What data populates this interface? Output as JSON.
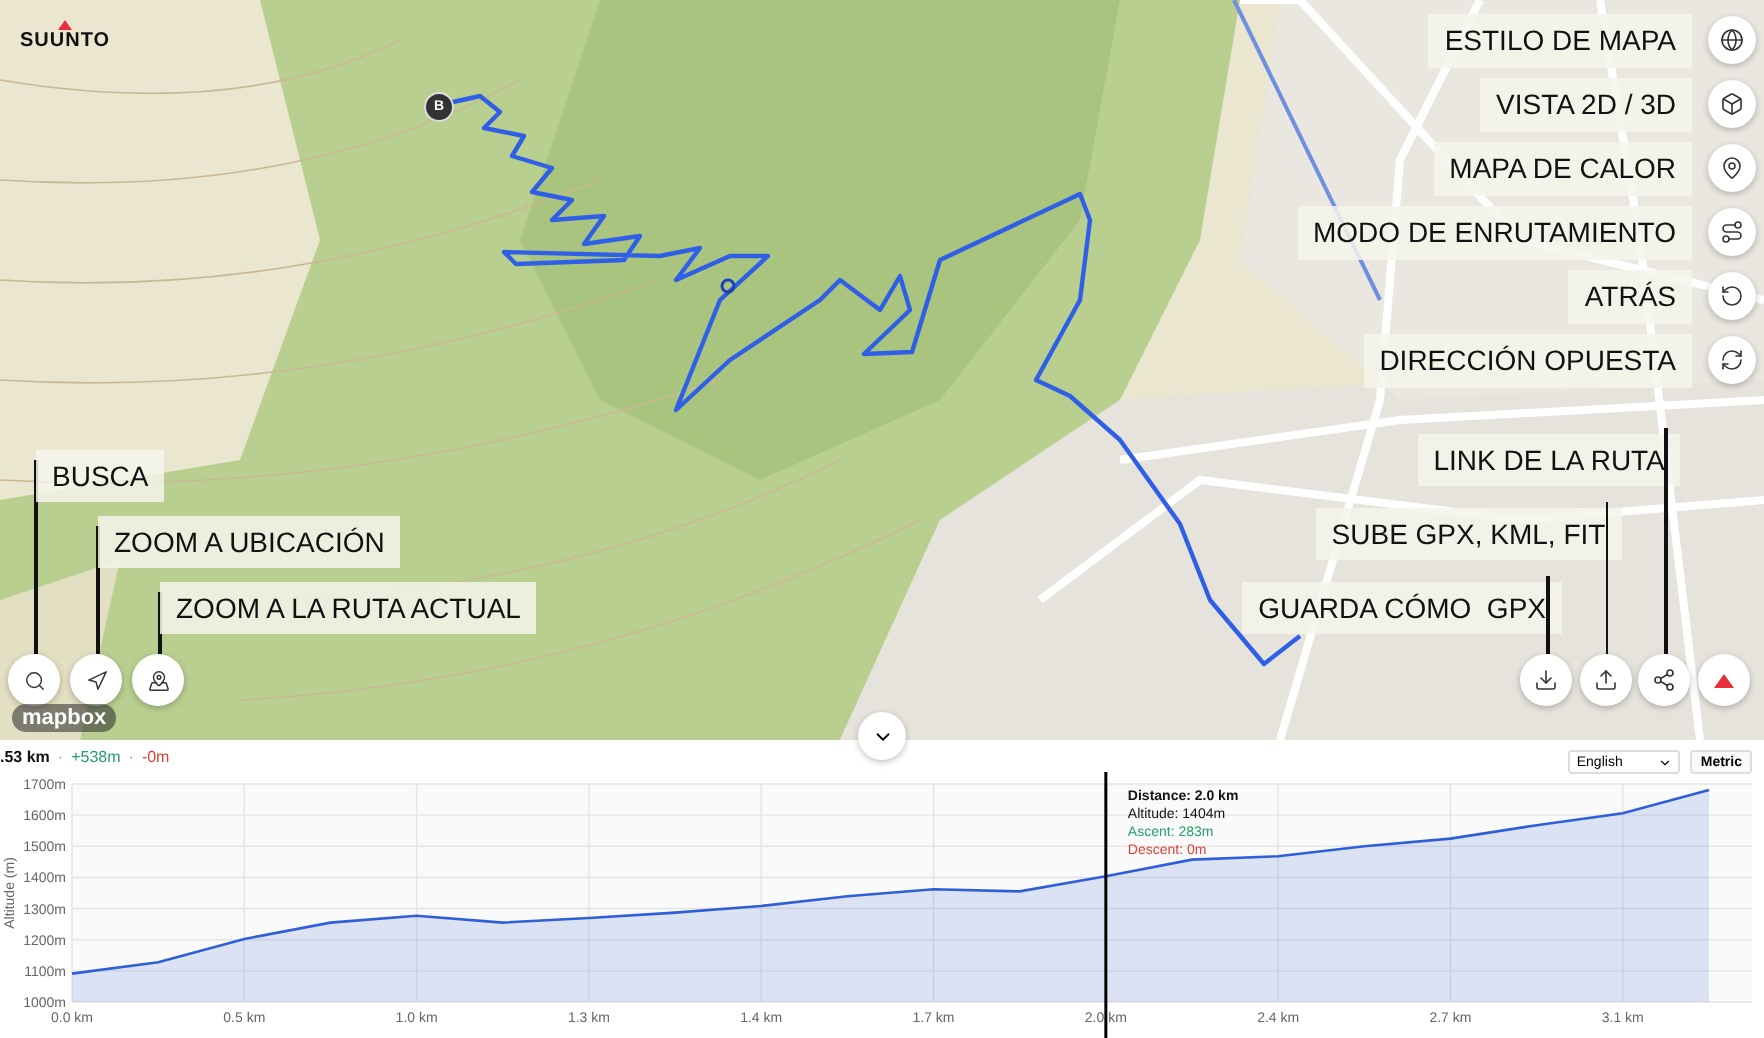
{
  "logo": {
    "name": "SUUNTO"
  },
  "map": {
    "marker": "B",
    "attribution": "mapbox"
  },
  "side_controls": [
    {
      "label": "ESTILO DE MAPA"
    },
    {
      "label": "VISTA 2D / 3D"
    },
    {
      "label": "MAPA DE CALOR"
    },
    {
      "label": "MODO DE ENRUTAMIENTO"
    },
    {
      "label": "ATRÁS"
    },
    {
      "label": "DIRECCIÓN OPUESTA"
    }
  ],
  "bottom_left_controls": [
    {
      "label": "BUSCA"
    },
    {
      "label": "ZOOM A UBICACIÓN"
    },
    {
      "label": "ZOOM A LA RUTA ACTUAL"
    }
  ],
  "bottom_right_controls": [
    {
      "label": "LINK DE LA RUTA"
    },
    {
      "label": "SUBE GPX, KML, FIT"
    },
    {
      "label": "GUARDA CÓMO  GPX"
    }
  ],
  "summary": {
    "distance": ".53 km",
    "ascent": "+538m",
    "descent": "-0m",
    "separators": [
      "·",
      "·"
    ]
  },
  "language": {
    "value": "English"
  },
  "units": "Metric",
  "chart": {
    "chart_data": {
      "type": "area",
      "ylabel": "Altitude (m)",
      "categories": [
        "0.0 km",
        null,
        "0.5 km",
        null,
        "1.0 km",
        null,
        "1.3 km",
        null,
        "1.4 km",
        null,
        "1.7 km",
        null,
        "2.0 km",
        null,
        "2.4 km",
        null,
        "2.7 km",
        null,
        "3.1 km",
        null
      ],
      "series": [
        {
          "color": "#2f5fd8",
          "values": [
            1091,
            1128,
            1202,
            1255,
            1277,
            1255,
            1270,
            1287,
            1308,
            1340,
            1362,
            1355,
            1404,
            1457,
            1468,
            1500,
            1525,
            1568,
            1606,
            1681
          ]
        }
      ],
      "ylim": [
        1000,
        1700
      ],
      "yticks": [
        {
          "value": 1000,
          "label": "1000m"
        },
        {
          "value": 1100,
          "label": "1100m"
        },
        {
          "value": 1200,
          "label": "1200m"
        },
        {
          "value": 1300,
          "label": "1300m"
        },
        {
          "value": 1400,
          "label": "1400m"
        },
        {
          "value": 1500,
          "label": "1500m"
        },
        {
          "value": 1600,
          "label": "1600m"
        },
        {
          "value": 1700,
          "label": "1700m"
        }
      ],
      "grid": true,
      "annotations": [
        {
          "x": "2.0 km"
        }
      ]
    },
    "tooltip": {
      "distance": "Distance: 2.0 km",
      "altitude": "Altitude: 1404m",
      "ascent": "Ascent: 283m",
      "descent": "Descent: 0m"
    }
  }
}
